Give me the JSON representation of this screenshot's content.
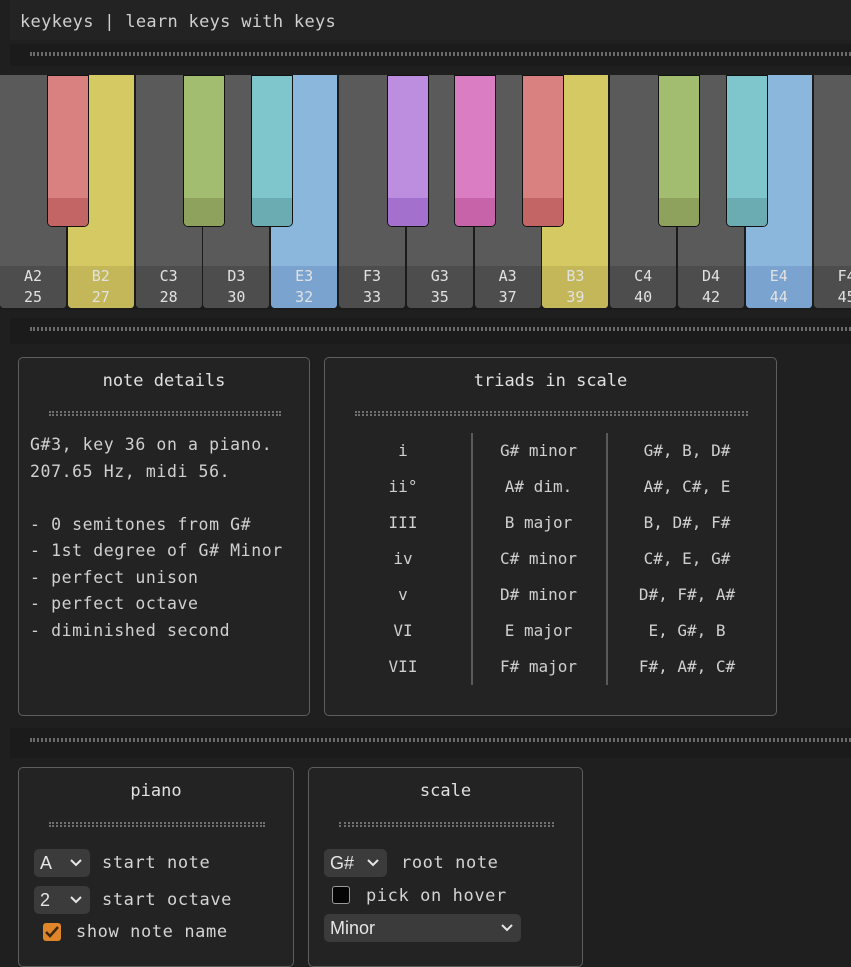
{
  "app": {
    "title": "keykeys | learn keys with keys"
  },
  "piano_keys": {
    "white": [
      {
        "note": "A2",
        "num": "25",
        "color": "#5a5a5a",
        "label_bg": "#4d4d4d"
      },
      {
        "note": "B2",
        "num": "27",
        "color": "#d5c964",
        "label_bg": "#c3b759"
      },
      {
        "note": "C3",
        "num": "28",
        "color": "#5a5a5a",
        "label_bg": "#4d4d4d"
      },
      {
        "note": "D3",
        "num": "30",
        "color": "#5a5a5a",
        "label_bg": "#4d4d4d"
      },
      {
        "note": "E3",
        "num": "32",
        "color": "#8cb7dc",
        "label_bg": "#7aa3d0"
      },
      {
        "note": "F3",
        "num": "33",
        "color": "#5a5a5a",
        "label_bg": "#4d4d4d"
      },
      {
        "note": "G3",
        "num": "35",
        "color": "#5a5a5a",
        "label_bg": "#4d4d4d"
      },
      {
        "note": "A3",
        "num": "37",
        "color": "#5a5a5a",
        "label_bg": "#4d4d4d"
      },
      {
        "note": "B3",
        "num": "39",
        "color": "#d5c964",
        "label_bg": "#c3b759"
      },
      {
        "note": "C4",
        "num": "40",
        "color": "#5a5a5a",
        "label_bg": "#4d4d4d"
      },
      {
        "note": "D4",
        "num": "42",
        "color": "#5a5a5a",
        "label_bg": "#4d4d4d"
      },
      {
        "note": "E4",
        "num": "44",
        "color": "#8cb7dc",
        "label_bg": "#7aa3d0"
      },
      {
        "note": "F4",
        "num": "45",
        "color": "#5a5a5a",
        "label_bg": "#4d4d4d"
      }
    ],
    "black": [
      {
        "color": "#d98080",
        "shade": "#c46565"
      },
      {
        "color": "#a3bd70",
        "shade": "#8ea25d"
      },
      {
        "color": "#7fc6cc",
        "shade": "#6aacb2"
      },
      {
        "color": "#bd8ee0",
        "shade": "#a370cd"
      },
      {
        "color": "#db7dc2",
        "shade": "#c663a9"
      },
      {
        "color": "#d98080",
        "shade": "#c46565"
      },
      {
        "color": "#a3bd70",
        "shade": "#8ea25d"
      },
      {
        "color": "#7fc6cc",
        "shade": "#6aacb2"
      }
    ]
  },
  "note_details": {
    "title": "note details",
    "lines": "G#3, key 36 on a piano.\n207.65 Hz, midi 56.\n\n- 0 semitones from G#\n- 1st degree of G# Minor\n- perfect unison\n- perfect octave\n- diminished second"
  },
  "triads": {
    "title": "triads in scale",
    "numerals": [
      "i",
      "ii°",
      "III",
      "iv",
      "v",
      "VI",
      "VII"
    ],
    "names": [
      "G# minor",
      "A# dim.",
      "B major",
      "C# minor",
      "D# minor",
      "E major",
      "F# major"
    ],
    "notes": [
      "G#, B, D#",
      "A#, C#, E",
      "B, D#, F#",
      "C#, E, G#",
      "D#, F#, A#",
      "E, G#, B",
      "F#, A#, C#"
    ]
  },
  "piano_panel": {
    "title": "piano",
    "start_note_value": "A",
    "start_note_label": "start note",
    "start_octave_value": "2",
    "start_octave_label": "start octave",
    "show_note_name_label": "show note name"
  },
  "scale_panel": {
    "title": "scale",
    "root_note_value": "G#",
    "root_note_label": "root note",
    "pick_on_hover_label": "pick on hover",
    "scale_value": "Minor"
  },
  "icons": {
    "chevron": "chevron-down-icon",
    "check": "check-icon"
  }
}
